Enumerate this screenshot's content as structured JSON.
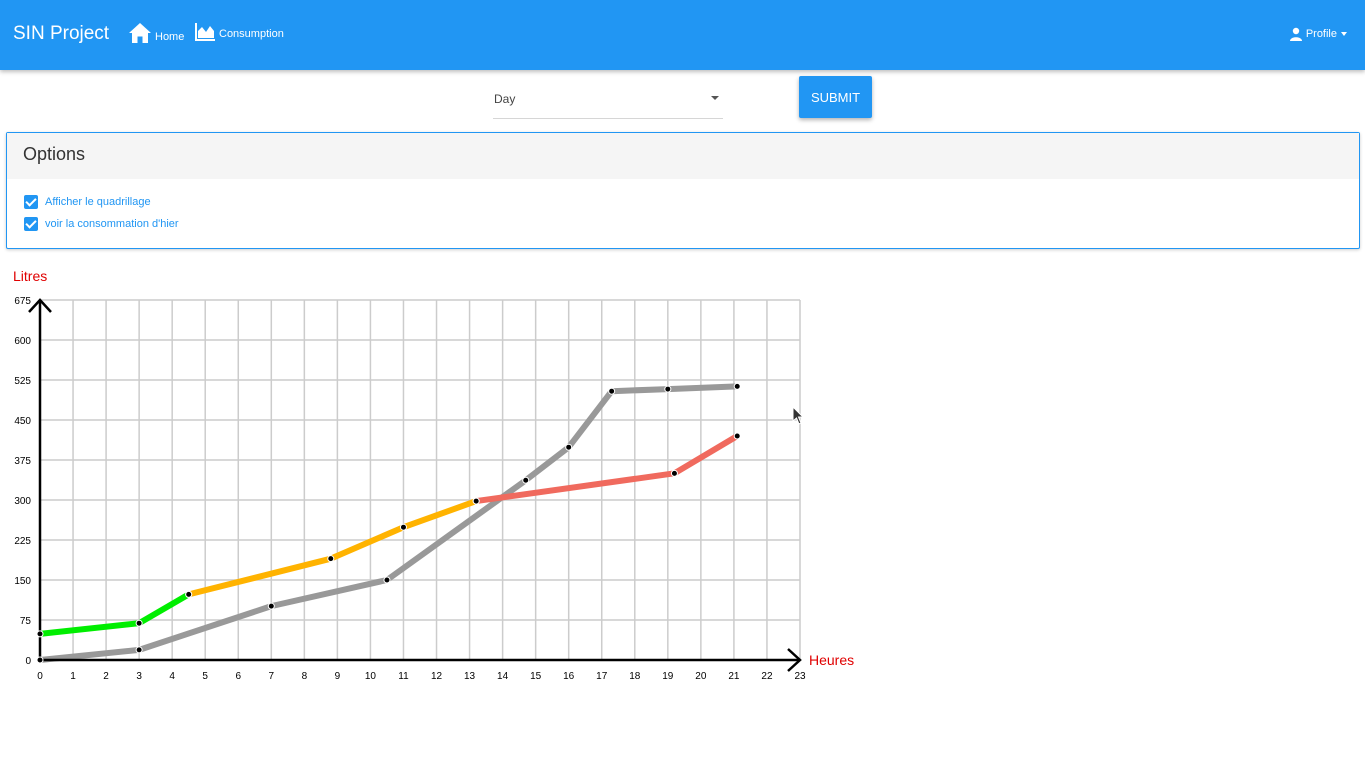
{
  "navbar": {
    "brand": "SIN Project",
    "links": [
      {
        "label": "Home",
        "icon": "home-icon"
      },
      {
        "label": "Consumption",
        "icon": "area-chart-icon"
      }
    ],
    "profile_label": "Profile",
    "profile_icon": "user-icon",
    "color": "#2196f3"
  },
  "controls": {
    "period_selected": "Day",
    "submit_label": "SUBMIT"
  },
  "options": {
    "title": "Options",
    "checkboxes": [
      {
        "label": "Afficher le quadrillage",
        "checked": true
      },
      {
        "label": "voir la consommation d'hier",
        "checked": true
      }
    ]
  },
  "chart_data": {
    "type": "line",
    "ylabel": "Litres",
    "xlabel": "Heures",
    "xlim": [
      0,
      23
    ],
    "ylim": [
      0,
      675
    ],
    "x_ticks": [
      0,
      1,
      2,
      3,
      4,
      5,
      6,
      7,
      8,
      9,
      10,
      11,
      12,
      13,
      14,
      15,
      16,
      17,
      18,
      19,
      20,
      21,
      22,
      23
    ],
    "y_ticks": [
      0,
      75,
      150,
      225,
      300,
      375,
      450,
      525,
      600,
      675
    ],
    "grid": true,
    "label_color": "#e00000",
    "series": [
      {
        "role": "yesterday",
        "color": "#999999",
        "points": [
          [
            0,
            0
          ],
          [
            3,
            19
          ],
          [
            7,
            101
          ],
          [
            10.5,
            150
          ],
          [
            14.7,
            337
          ],
          [
            16,
            399
          ],
          [
            17.3,
            504
          ],
          [
            19,
            508
          ],
          [
            21.1,
            513
          ]
        ]
      },
      {
        "role": "today",
        "segments": [
          {
            "color": "#00ee00",
            "points": [
              [
                0,
                49
              ],
              [
                3,
                69
              ],
              [
                4.5,
                123
              ]
            ]
          },
          {
            "color": "#ffb300",
            "points": [
              [
                4.5,
                123
              ],
              [
                8.8,
                190
              ],
              [
                11,
                249
              ],
              [
                13.2,
                298
              ]
            ]
          },
          {
            "color": "#f06a5e",
            "points": [
              [
                13.2,
                298
              ],
              [
                19.2,
                350
              ],
              [
                21.1,
                420
              ]
            ]
          }
        ]
      }
    ]
  }
}
